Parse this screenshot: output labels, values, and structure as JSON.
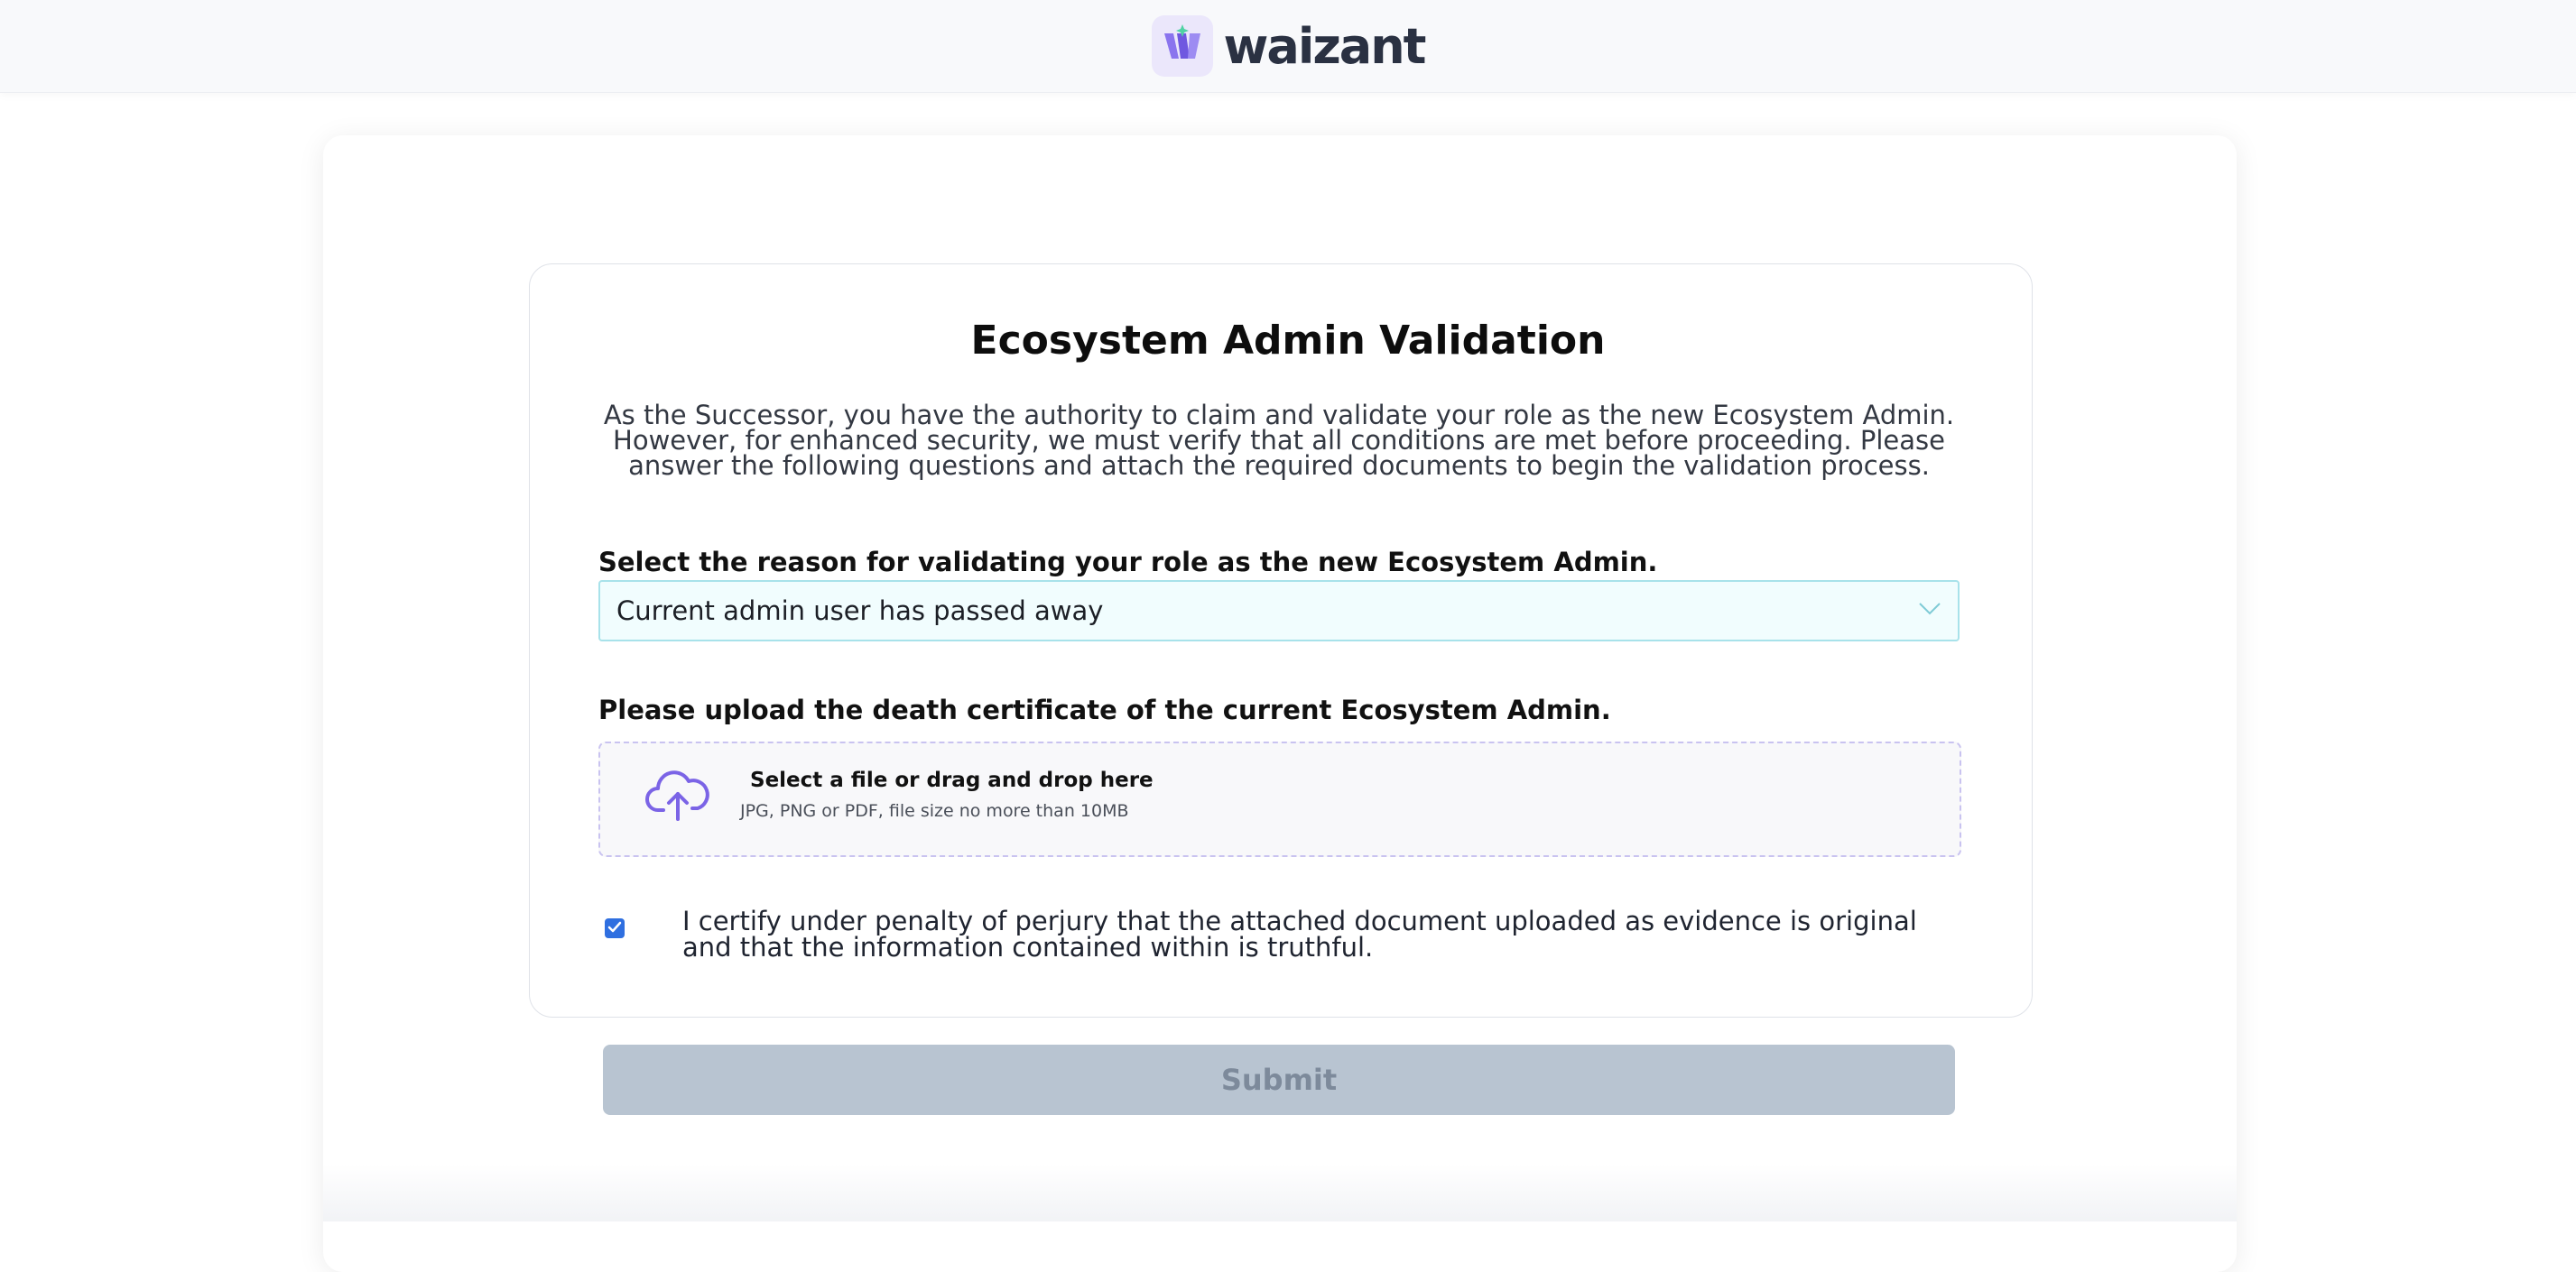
{
  "header": {
    "brand_name": "waizant",
    "logo_icon": "waizant-w-logo",
    "brand_color": "#7a62e6"
  },
  "form": {
    "title": "Ecosystem Admin Validation",
    "description": "As the Successor, you have the authority to claim and validate your role as the new Ecosystem Admin.  However, for enhanced security, we must verify that all conditions are met before proceeding. Please answer the following questions and attach the required documents to begin the validation process.",
    "reason_label": "Select the reason for validating your role as the new Ecosystem Admin.",
    "reason_value": "Current admin user has passed away",
    "upload_label": "Please upload the death certificate of the current Ecosystem Admin.",
    "upload_title": "Select a file or drag and drop here",
    "upload_hint": "JPG, PNG or PDF, file size no more than 10MB",
    "certify_checked": true,
    "certify_text": "I certify under penalty of perjury that the attached document uploaded as evidence is original and that the information contained within is truthful.",
    "submit_label": "Submit"
  },
  "colors": {
    "select_border": "#a8e2ea",
    "select_bg": "#f1fdfe",
    "upload_border": "#c9c3f0",
    "checkbox": "#2f6fe0",
    "submit_bg_disabled": "#b8c4d1",
    "submit_text_disabled": "#7d8a9b"
  }
}
